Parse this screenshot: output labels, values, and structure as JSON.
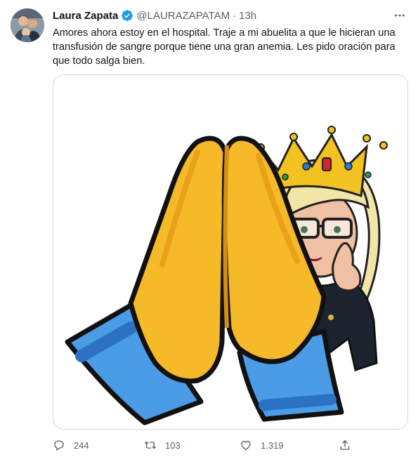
{
  "tweet": {
    "author_name": "Laura Zapata",
    "handle": "@LAURAZAPATAM",
    "separator": "·",
    "time": "13h",
    "text": "Amores ahora estoy en el hospital. Traje a mi abuelita a que le hicieran una transfusión de sangre porque tiene una gran anemia. Les pido oración para que todo salga bien.",
    "verified": true
  },
  "actions": {
    "replies": "244",
    "retweets": "103",
    "likes": "1.319"
  },
  "icons": {
    "verified": "verified-badge-icon",
    "more": "more-icon",
    "reply": "reply-icon",
    "retweet": "retweet-icon",
    "like": "heart-icon",
    "share": "share-icon"
  },
  "colors": {
    "verified": "#1d9bf0",
    "text": "#0f1419",
    "secondary": "#536471",
    "border": "#cfd9de"
  }
}
